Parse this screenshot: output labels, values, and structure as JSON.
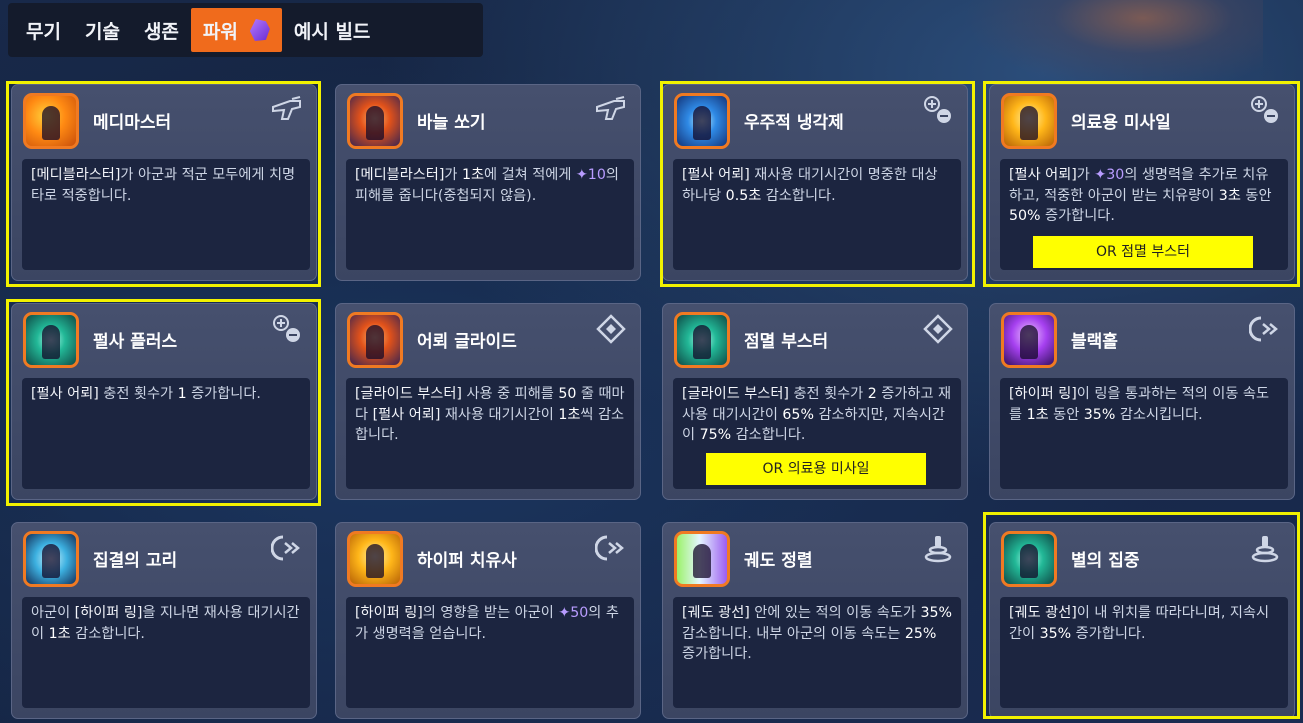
{
  "tabs": [
    {
      "label": "무기"
    },
    {
      "label": "기술"
    },
    {
      "label": "생존"
    },
    {
      "label": "파워",
      "active": true,
      "icon": "purple-gem-icon"
    },
    {
      "label": "예시 빌드"
    }
  ],
  "colors": {
    "accent": "#f06b1c",
    "highlight": "#f2f200",
    "heal": "#b89cff"
  },
  "cards": [
    {
      "title": "메디마스터",
      "icon": "blaster-gun-icon",
      "desc": [
        "[메디블라스터]",
        "가 아군과 적군 모두에게 치명타로 적중합니다."
      ]
    },
    {
      "title": "바늘 쏘기",
      "icon": "blaster-gun-icon",
      "desc": [
        "[메디블라스터]",
        "가 ",
        "1초",
        "에 걸쳐 적에게 ",
        "10",
        "의 피해를 줍니다(중첩되지 않음)."
      ]
    },
    {
      "title": "우주적 냉각제",
      "icon": "plus-minus-icon",
      "desc": [
        "[펄사 어뢰]",
        " 재사용 대기시간이 명중한 대상 하나당 ",
        "0.5초",
        " 감소합니다."
      ]
    },
    {
      "title": "의료용 미사일",
      "icon": "plus-minus-icon",
      "desc": [
        "[펄사 어뢰]",
        "가 ",
        "30",
        "의 생명력을 추가로 치유하고, 적중한 아군이 받는 치유량이 ",
        "3초",
        " 동안 ",
        "50%",
        " 증가합니다."
      ],
      "note": "OR 점멸 부스터"
    },
    {
      "title": "펄사 플러스",
      "icon": "plus-minus-icon",
      "desc": [
        "[펄사 어뢰]",
        " 충전 횟수가 ",
        "1",
        " 증가합니다."
      ]
    },
    {
      "title": "어뢰 글라이드",
      "icon": "diamond-arrows-icon",
      "desc": [
        "[글라이드 부스터]",
        " 사용 중 피해를 ",
        "50",
        " 줄 때마다 ",
        "[펄사 어뢰]",
        " 재사용 대기시간이 ",
        "1초",
        "씩 감소합니다."
      ]
    },
    {
      "title": "점멸 부스터",
      "icon": "diamond-arrows-icon",
      "desc": [
        "[글라이드 부스터]",
        " 충전 횟수가 ",
        "2",
        " 증가하고 재사용 대기시간이 ",
        "65%",
        " 감소하지만, 지속시간이 ",
        "75%",
        " 감소합니다."
      ],
      "note": "OR 의료용 미사일"
    },
    {
      "title": "블랙홀",
      "icon": "ring-arrow-icon",
      "desc": [
        "[하이퍼 링]",
        "이 링을 통과하는 적의 이동 속도를 ",
        "1초",
        " 동안 ",
        "35%",
        " 감소시킵니다."
      ]
    },
    {
      "title": "집결의 고리",
      "icon": "ring-arrow-icon",
      "desc": [
        "아군이 ",
        "[하이퍼 링]",
        "을 지나면 재사용 대기시간이 ",
        "1초",
        " 감소합니다."
      ]
    },
    {
      "title": "하이퍼 치유사",
      "icon": "ring-arrow-icon",
      "desc": [
        "[하이퍼 링]",
        "의 영향을 받는 아군이 ",
        "50",
        "의 추가 생명력을 얻습니다."
      ]
    },
    {
      "title": "궤도 정렬",
      "icon": "beam-emitter-icon",
      "desc": [
        "[궤도 광선]",
        " 안에 있는 적의 이동 속도가 ",
        "35%",
        " 감소합니다. 내부 아군의 이동 속도는 ",
        "25%",
        " 증가합니다."
      ]
    },
    {
      "title": "별의 집중",
      "icon": "beam-emitter-icon",
      "desc": [
        "[궤도 광선]",
        "이 내 위치를 따라다니며, 지속시간이 ",
        "35%",
        " 증가합니다."
      ]
    }
  ]
}
